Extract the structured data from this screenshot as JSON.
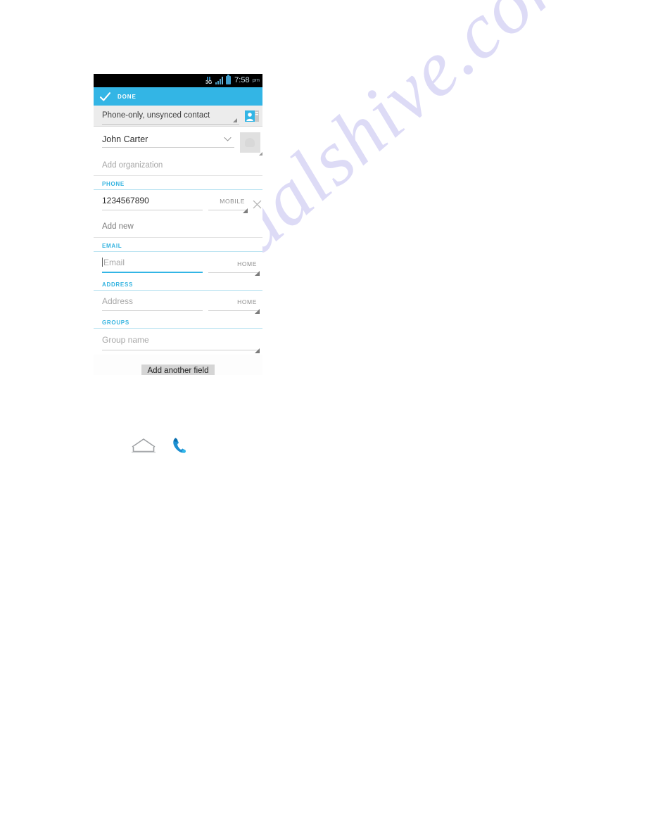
{
  "page": {
    "watermark": "manualshive.com",
    "watermark_color": "#c9c6f2"
  },
  "phone_screenshot": {
    "status_bar": {
      "network_label": "3G",
      "network_icon": "data-up-down-arrows-icon",
      "signal_icon": "signal-bars-icon",
      "battery_icon": "battery-full-icon",
      "time": "7:58",
      "am_pm": "pm"
    },
    "action_bar": {
      "accent_color": "#33b5e5",
      "check_icon": "check-icon",
      "done_label": "DONE"
    },
    "account_selector": {
      "value": "Phone-only, unsynced contact",
      "dropdown_icon": "spinner-corner-icon",
      "account_icon": "contact-card-icon"
    },
    "name_field": {
      "value": "John Carter",
      "expand_icon": "chevron-down-icon",
      "photo_placeholder_icon": "contact-photo-placeholder-icon"
    },
    "organization_field": {
      "placeholder": "Add organization"
    },
    "sections": [
      {
        "header": "PHONE",
        "rows": [
          {
            "value": "1234567890",
            "is_hint": false,
            "focused": false,
            "type_label": "MOBILE",
            "has_delete": true,
            "delete_icon": "close-icon"
          }
        ],
        "add_new_label": "Add new"
      },
      {
        "header": "EMAIL",
        "rows": [
          {
            "value": "Email",
            "is_hint": true,
            "focused": true,
            "type_label": "HOME",
            "has_delete": false
          }
        ]
      },
      {
        "header": "ADDRESS",
        "rows": [
          {
            "value": "Address",
            "is_hint": true,
            "focused": false,
            "type_label": "HOME",
            "has_delete": false
          }
        ]
      },
      {
        "header": "GROUPS",
        "group_row": {
          "value": "Group name",
          "is_hint": true,
          "dropdown_icon": "spinner-corner-icon"
        }
      }
    ],
    "add_another_field_button": "Add another field"
  },
  "nav_icons": [
    {
      "name": "home-icon",
      "label": "Home"
    },
    {
      "name": "phone-handset-icon",
      "label": "Phone"
    }
  ]
}
